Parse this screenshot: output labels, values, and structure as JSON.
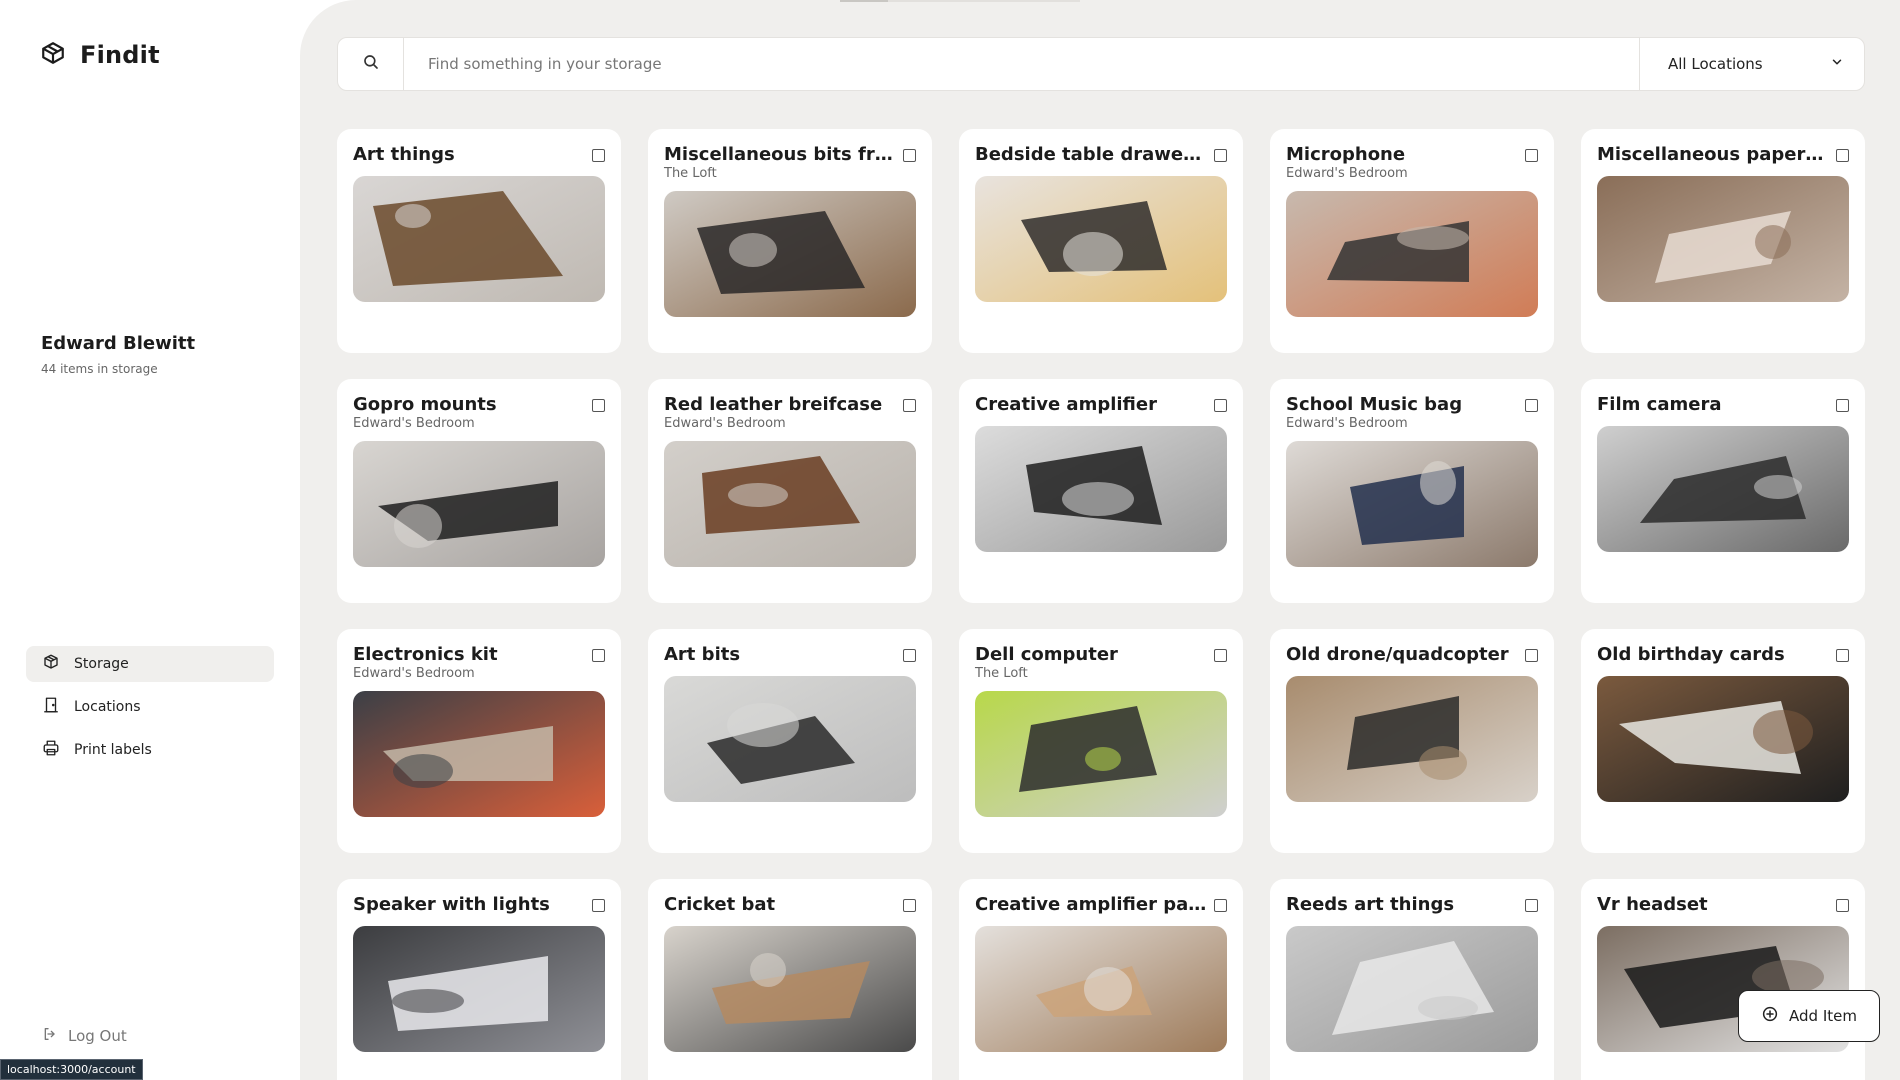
{
  "app": {
    "name": "Findit"
  },
  "profile": {
    "name": "Edward Blewitt",
    "items_count": "44 items in storage"
  },
  "nav": [
    {
      "label": "Storage",
      "icon": "package-icon",
      "active": true
    },
    {
      "label": "Locations",
      "icon": "door-icon",
      "active": false
    },
    {
      "label": "Print labels",
      "icon": "printer-icon",
      "active": false
    }
  ],
  "logout_label": "Log Out",
  "status_url": "localhost:3000/account",
  "search": {
    "placeholder": "Find something in your storage",
    "value": ""
  },
  "location_filter": {
    "selected": "All Locations"
  },
  "add_item_label": "Add Item",
  "items": [
    {
      "title": "Art things",
      "location": "",
      "photo": "wood",
      "colors": [
        "#d9d6d4",
        "#6b4a2c",
        "#bfb9b2"
      ]
    },
    {
      "title": "Miscellaneous bits from...",
      "location": "The Loft",
      "photo": "boxes",
      "colors": [
        "#cfcac4",
        "#2a2828",
        "#8b6a4c"
      ]
    },
    {
      "title": "Bedside table drawer bits",
      "location": "",
      "photo": "drawer",
      "colors": [
        "#e8e3de",
        "#2f2d2c",
        "#e4c17a"
      ]
    },
    {
      "title": "Microphone",
      "location": "Edward's Bedroom",
      "photo": "mic",
      "colors": [
        "#c7b9ae",
        "#343434",
        "#d17c56"
      ]
    },
    {
      "title": "Miscellaneous paper fro...",
      "location": "",
      "photo": "paper",
      "colors": [
        "#8a6e58",
        "#e7dcd2",
        "#c4b3a5"
      ]
    },
    {
      "title": "Gopro mounts",
      "location": "Edward's Bedroom",
      "photo": "bag",
      "colors": [
        "#d8d5d1",
        "#1e1e1e",
        "#a7a3a0"
      ]
    },
    {
      "title": "Red leather breifcase",
      "location": "Edward's Bedroom",
      "photo": "case",
      "colors": [
        "#d3cfca",
        "#6a3d22",
        "#b8b2ab"
      ]
    },
    {
      "title": "Creative amplifier",
      "location": "",
      "photo": "amp",
      "colors": [
        "#dcdcdc",
        "#1f1f1f",
        "#9a9a9a"
      ]
    },
    {
      "title": "School Music bag",
      "location": "Edward's Bedroom",
      "photo": "music",
      "colors": [
        "#dedad6",
        "#23304e",
        "#8c7a6c"
      ]
    },
    {
      "title": "Film camera",
      "location": "",
      "photo": "camera",
      "colors": [
        "#cfcfcf",
        "#2b2b2b",
        "#6a6a6a"
      ]
    },
    {
      "title": "Electronics kit",
      "location": "Edward's Bedroom",
      "photo": "kit",
      "colors": [
        "#3b3f46",
        "#c4b9a8",
        "#d95f3a"
      ]
    },
    {
      "title": "Art bits",
      "location": "",
      "photo": "sketch",
      "colors": [
        "#d9d9d7",
        "#2a2a2a",
        "#bdbdbd"
      ]
    },
    {
      "title": "Dell computer",
      "location": "The Loft",
      "photo": "pc",
      "colors": [
        "#b8d84a",
        "#2d2d2d",
        "#cfcfcf"
      ]
    },
    {
      "title": "Old drone/quadcopter",
      "location": "",
      "photo": "drone",
      "colors": [
        "#a88c6e",
        "#2c2b2a",
        "#d8d1c9"
      ]
    },
    {
      "title": "Old birthday cards",
      "location": "",
      "photo": "cards",
      "colors": [
        "#7b5a3e",
        "#e8e6e1",
        "#1f1f1f"
      ]
    },
    {
      "title": "Speaker with lights",
      "location": "",
      "photo": "speaker",
      "colors": [
        "#3c3d40",
        "#e9e9ec",
        "#8f9096"
      ]
    },
    {
      "title": "Cricket bat",
      "location": "",
      "photo": "bat",
      "colors": [
        "#d8d3cc",
        "#b48a62",
        "#4a4a4a"
      ]
    },
    {
      "title": "Creative amplifier parts",
      "location": "",
      "photo": "box",
      "colors": [
        "#e4e0dc",
        "#cba37a",
        "#9e7b5a"
      ]
    },
    {
      "title": "Reeds art things",
      "location": "",
      "photo": "plastic",
      "colors": [
        "#c9c9c9",
        "#e8e8e8",
        "#9b9b9b"
      ]
    },
    {
      "title": "Vr headset",
      "location": "",
      "photo": "vr",
      "colors": [
        "#7c6e62",
        "#1a1a1a",
        "#e2e2e2"
      ]
    }
  ]
}
